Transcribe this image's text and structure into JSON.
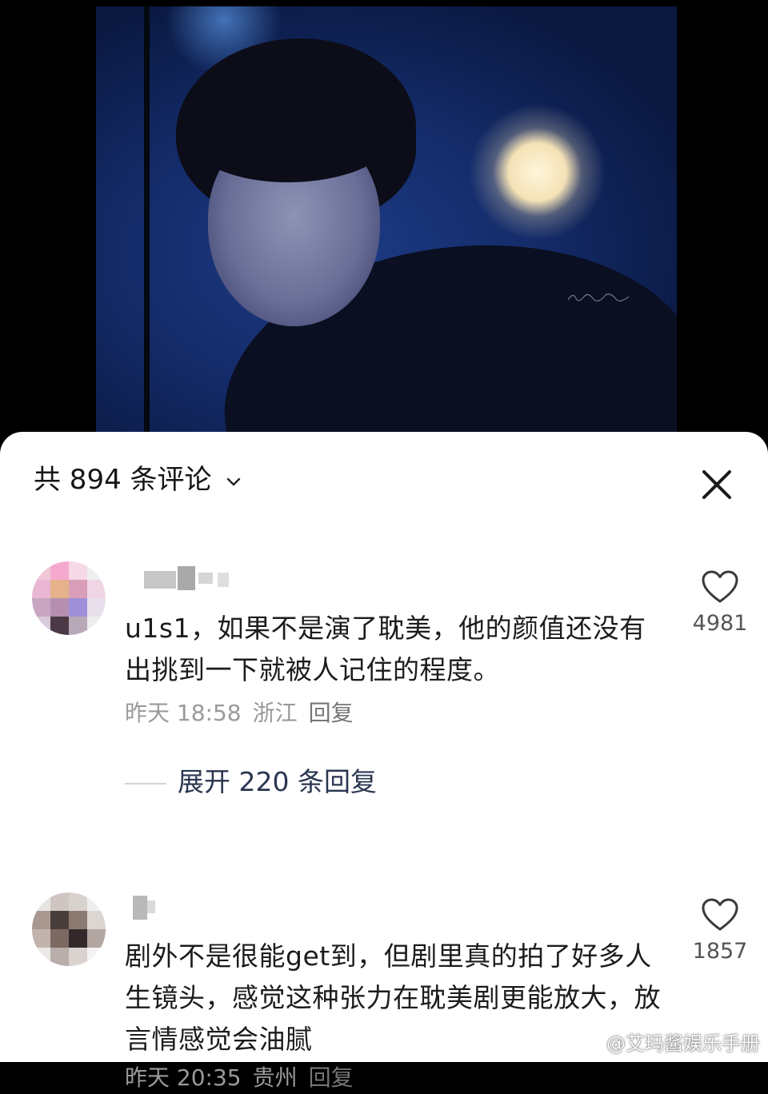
{
  "header": {
    "comment_count_label": "共 894 条评论"
  },
  "comments": [
    {
      "text": "u1s1，如果不是演了耽美，他的颜值还没有出挑到一下就被人记住的程度。",
      "time": "昨天 18:58",
      "location": "浙江",
      "reply_label": "回复",
      "likes": "4981",
      "expand_label": "展开 220 条回复"
    },
    {
      "text": "剧外不是很能get到，但剧里真的拍了好多人生镜头，感觉这种张力在耽美剧更能放大，放言情感觉会油腻",
      "time": "昨天 20:35",
      "location": "贵州",
      "reply_label": "回复",
      "likes": "1857"
    }
  ],
  "watermark": {
    "text": "@艾玛酱娱乐手册"
  },
  "colors": {
    "sheet_background": "#ffffff",
    "page_background": "#000000",
    "primary_text": "#1c1c1c",
    "meta_text": "#9a9a9a",
    "expand_text": "#2a3650"
  },
  "icons": [
    "chevron-down-icon",
    "close-icon",
    "heart-icon",
    "weibo-logo-icon"
  ]
}
